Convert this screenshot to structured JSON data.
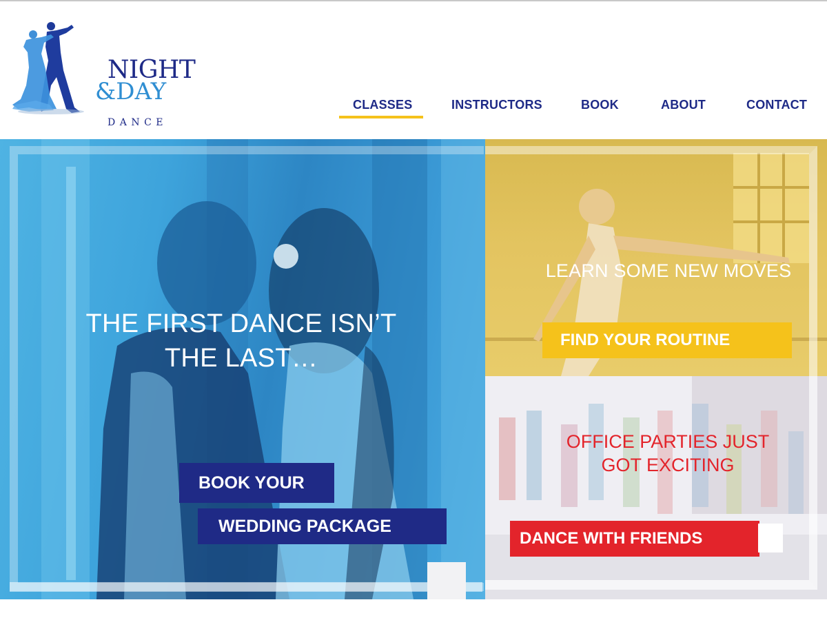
{
  "brand": {
    "logo_line1": "NIGHT",
    "logo_line2": "&DAY",
    "logo_line3": "DANCE",
    "primary_color": "#1e2a87",
    "accent_blue": "#2f8ed2",
    "accent_yellow": "#f5c21b",
    "accent_red": "#e3242b"
  },
  "nav": {
    "items": [
      {
        "label": "CLASSES",
        "active": true
      },
      {
        "label": "INSTRUCTORS",
        "active": false
      },
      {
        "label": "BOOK",
        "active": false
      },
      {
        "label": "ABOUT",
        "active": false
      },
      {
        "label": "CONTACT",
        "active": false
      }
    ]
  },
  "hero": {
    "wedding": {
      "headline_line1": "THE FIRST DANCE ISN’T",
      "headline_line2": "THE LAST…",
      "cta_line1": "BOOK YOUR",
      "cta_line2": "WEDDING PACKAGE"
    },
    "classes": {
      "headline": "LEARN SOME NEW MOVES",
      "cta": "FIND YOUR ROUTINE"
    },
    "corporate": {
      "headline_line1": "OFFICE PARTIES JUST",
      "headline_line2": "GOT EXCITING",
      "cta": "DANCE WITH FRIENDS"
    }
  }
}
